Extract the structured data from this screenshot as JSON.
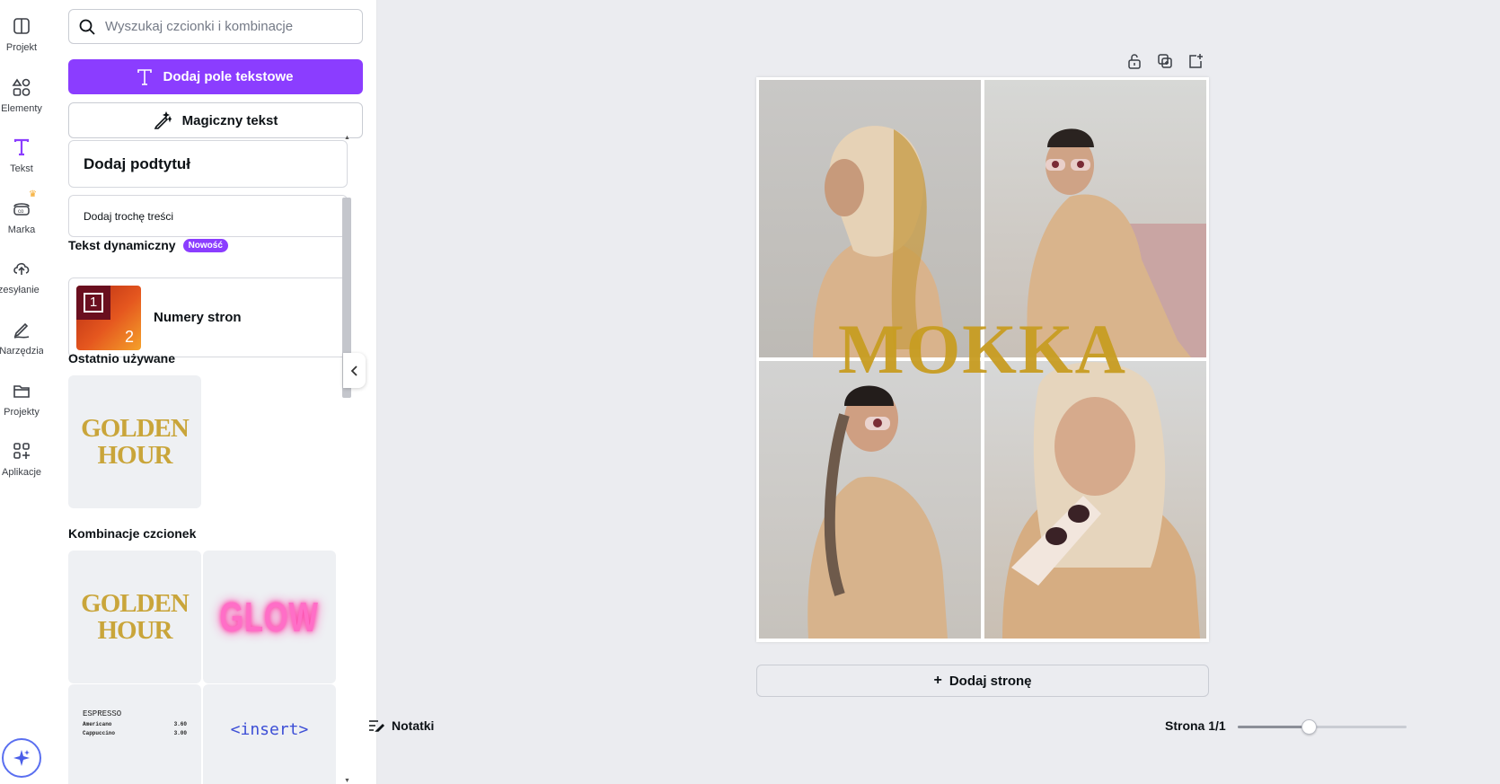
{
  "rail": {
    "items": [
      {
        "label": "Projekt",
        "icon": "layout-icon"
      },
      {
        "label": "Elementy",
        "icon": "shapes-icon"
      },
      {
        "label": "Tekst",
        "icon": "text-icon"
      },
      {
        "label": "Marka",
        "icon": "brand-icon"
      },
      {
        "label": "rzesyłanie",
        "icon": "cloud-upload-icon"
      },
      {
        "label": "Narzędzia",
        "icon": "pen-icon"
      },
      {
        "label": "Projekty",
        "icon": "folder-icon"
      },
      {
        "label": "Aplikacje",
        "icon": "apps-icon"
      }
    ],
    "active": "Tekst"
  },
  "panel": {
    "search_placeholder": "Wyszukaj czcionki i kombinacje",
    "add_textbox_label": "Dodaj pole tekstowe",
    "magic_text_label": "Magiczny tekst",
    "add_subtitle_label": "Dodaj podtytuł",
    "add_body_label": "Dodaj trochę treści",
    "dynamic_text_title": "Tekst dynamiczny",
    "new_badge": "Nowość",
    "page_numbers_label": "Numery stron",
    "page_numbers_thumb": {
      "n1": "1",
      "n2": "2"
    },
    "recent_title": "Ostatnio używane",
    "combos_title": "Kombinacje czcionek",
    "tiles": {
      "golden_line1": "GOLDEN",
      "golden_line2": "HOUR",
      "glow": "GLOW",
      "espresso_title": "ESPRESSO",
      "espresso_rows": [
        {
          "name": "Americano",
          "price": "3.60"
        },
        {
          "name": "Cappuccino",
          "price": "3.00"
        }
      ],
      "insert": "<insert>"
    }
  },
  "canvas": {
    "title_text": "MOKKA",
    "add_page_label": "Dodaj stronę"
  },
  "footer": {
    "notes_label": "Notatki",
    "page_indicator": "Strona 1/1",
    "zoom_fraction": 0.42
  },
  "colors": {
    "accent": "#8b3dff",
    "golden_text": "#c9a53a",
    "glow_pink": "#ff6ec7",
    "title_gold": "#c89d22"
  }
}
